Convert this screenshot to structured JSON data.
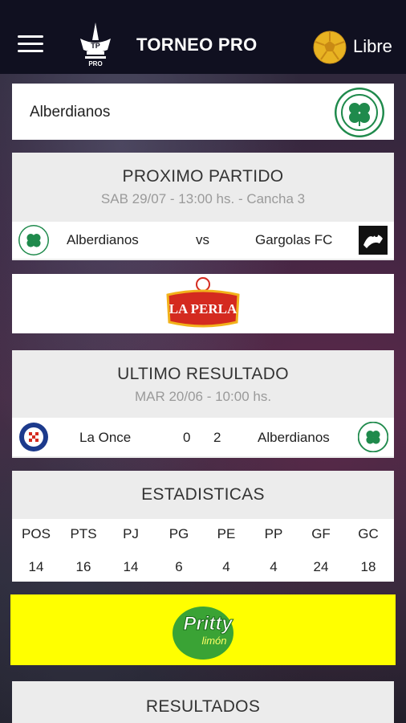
{
  "header": {
    "title": "TORNEO PRO",
    "logo_text": "TP",
    "logo_sub": "PRO",
    "status_label": "Libre"
  },
  "team": {
    "name": "Alberdianos"
  },
  "next_match": {
    "heading": "PROXIMO PARTIDO",
    "details": "SAB 29/07 - 13:00 hs. - Cancha 3",
    "home": "Alberdianos",
    "vs": "vs",
    "away": "Gargolas FC"
  },
  "ad_top": {
    "brand": "LA PERLA"
  },
  "last_result": {
    "heading": "ULTIMO RESULTADO",
    "details": "MAR 20/06 - 10:00 hs.",
    "home": "La Once",
    "home_score": "0",
    "away_score": "2",
    "away": "Alberdianos"
  },
  "stats": {
    "heading": "ESTADISTICAS",
    "columns": [
      "POS",
      "PTS",
      "PJ",
      "PG",
      "PE",
      "PP",
      "GF",
      "GC"
    ],
    "values": [
      "14",
      "16",
      "14",
      "6",
      "4",
      "4",
      "24",
      "18"
    ]
  },
  "ad_bottom": {
    "brand": "Pritty",
    "flavor": "limón"
  },
  "results": {
    "heading": "RESULTADOS"
  },
  "colors": {
    "topbar": "#101020",
    "celtic_green": "#1f8a4c",
    "ad_yellow": "#ffff00",
    "perla_red": "#d42a1f"
  }
}
